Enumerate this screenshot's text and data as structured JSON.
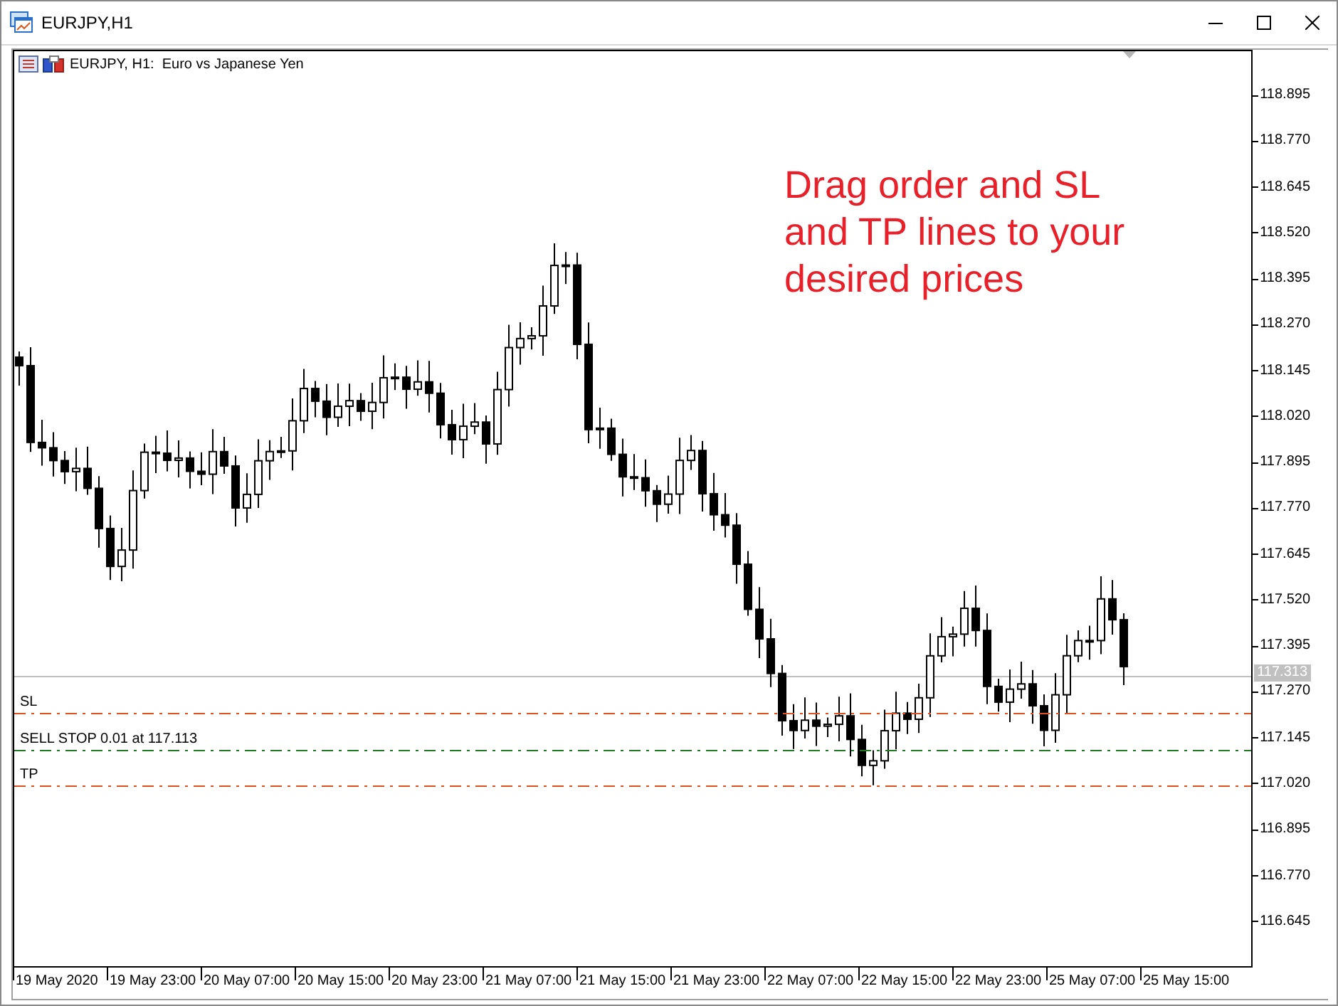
{
  "window": {
    "title": "EURJPY,H1"
  },
  "chart": {
    "header": "EURJPY, H1:  Euro vs Japanese Yen",
    "annotation": "Drag order and SL\nand TP lines to your\ndesired prices",
    "price_labels": [
      "118.895",
      "118.770",
      "118.645",
      "118.520",
      "118.395",
      "118.270",
      "118.145",
      "118.020",
      "117.895",
      "117.770",
      "117.645",
      "117.520",
      "117.395",
      "117.270",
      "117.145",
      "117.020",
      "116.895",
      "116.770",
      "116.645"
    ],
    "current_price": "117.313",
    "time_labels": [
      "19 May 2020",
      "19 May 23:00",
      "20 May 07:00",
      "20 May 15:00",
      "20 May 23:00",
      "21 May 07:00",
      "21 May 15:00",
      "21 May 23:00",
      "22 May 07:00",
      "22 May 15:00",
      "22 May 23:00",
      "25 May 07:00",
      "25 May 15:00"
    ],
    "order_lines": [
      {
        "kind": "stop_loss",
        "label": "SL",
        "color": "#e0501e"
      },
      {
        "kind": "pending",
        "label": "SELL STOP 0.01 at 117.113",
        "color": "#1e7a1e"
      },
      {
        "kind": "take_profit",
        "label": "TP",
        "color": "#e0501e"
      }
    ]
  }
}
